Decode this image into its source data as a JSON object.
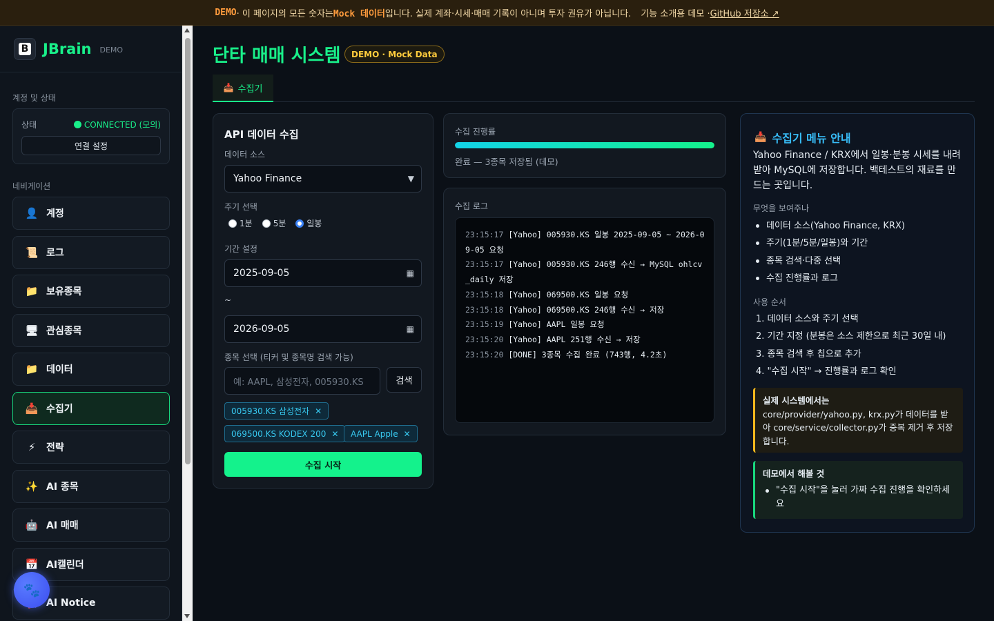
{
  "banner": {
    "demo": "DEMO",
    "text_a": " · 이 페이지의 모든 숫자는 ",
    "mock": "Mock 데이터",
    "text_b": "입니다. 실제 계좌·시세·매매 기록이 아니며 투자 권유가 아닙니다.",
    "text_c": "기능 소개용 데모 · ",
    "github": "GitHub 저장소 ↗"
  },
  "brand": {
    "logo_letter": "B",
    "name": "JBrain",
    "tag": "DEMO"
  },
  "account": {
    "section_label": "계정 및 상태",
    "status_key": "상태",
    "status_value": "CONNECTED (모의)",
    "connect_button": "연결 설정"
  },
  "nav": {
    "section_label": "네비게이션",
    "items": [
      {
        "label": "계정",
        "icon": "👤"
      },
      {
        "label": "로그",
        "icon": "📜"
      },
      {
        "label": "보유종목",
        "icon": "📁"
      },
      {
        "label": "관심종목",
        "icon": "🖥"
      },
      {
        "label": "데이터",
        "icon": "📁"
      },
      {
        "label": "수집기",
        "icon": "📥"
      },
      {
        "label": "전략",
        "icon": "⚡"
      },
      {
        "label": "AI 종목",
        "icon": "✨"
      },
      {
        "label": "AI 매매",
        "icon": "🤖"
      },
      {
        "label": "AI캘린더",
        "icon": "📅"
      },
      {
        "label": "AI Notice",
        "icon": "📢"
      }
    ],
    "active_index": 5
  },
  "fab_icon": "🐾",
  "page": {
    "title": "단타 매매 시스템",
    "badge": "DEMO · Mock Data",
    "tab": {
      "icon": "📥",
      "label": "수집기"
    }
  },
  "collect_form": {
    "title": "API 데이터 수집",
    "source_label": "데이터 소스",
    "source_value": "Yahoo Finance",
    "interval_label": "주기 선택",
    "interval_options": [
      "1분",
      "5분",
      "일봉"
    ],
    "interval_selected": "일봉",
    "period_label": "기간 설정",
    "start_date": "2025-09-05",
    "tilde": "~",
    "end_date": "2026-09-05",
    "ticker_label": "종목 선택 (티커 및 종목명 검색 가능)",
    "ticker_placeholder": "예: AAPL, 삼성전자, 005930.KS",
    "search_button": "검색",
    "chips": [
      "005930.KS 삼성전자",
      "069500.KS KODEX 200",
      "AAPL Apple"
    ],
    "start_button": "수집 시작"
  },
  "progress": {
    "label": "수집 진행률",
    "fraction": 1.0,
    "status": "완료 — 3종목 저장됨 (데모)"
  },
  "log": {
    "label": "수집 로그",
    "lines": [
      {
        "ts": "23:15:17",
        "msg": "[Yahoo] 005930.KS 일봉 2025-09-05 ~ 2026-09-05 요청"
      },
      {
        "ts": "23:15:17",
        "msg": "[Yahoo] 005930.KS 246행 수신 → MySQL ohlcv_daily 저장"
      },
      {
        "ts": "23:15:18",
        "msg": "[Yahoo] 069500.KS 일봉 요청"
      },
      {
        "ts": "23:15:18",
        "msg": "[Yahoo] 069500.KS 246행 수신 → 저장"
      },
      {
        "ts": "23:15:19",
        "msg": "[Yahoo] AAPL 일봉 요청"
      },
      {
        "ts": "23:15:20",
        "msg": "[Yahoo] AAPL 251행 수신 → 저장"
      },
      {
        "ts": "23:15:20",
        "msg": "[DONE] 3종목 수집 완료 (743행, 4.2초)"
      }
    ]
  },
  "guide": {
    "icon": "📥",
    "title": "수집기 메뉴 안내",
    "description": "Yahoo Finance / KRX에서 일봉·분봉 시세를 내려받아 MySQL에 저장합니다. 백테스트의 재료를 만드는 곳입니다.",
    "shows_label": "무엇을 보여주나",
    "shows": [
      "데이터 소스(Yahoo Finance, KRX)",
      "주기(1분/5분/일봉)와 기간",
      "종목 검색·다중 선택",
      "수집 진행률과 로그"
    ],
    "steps_label": "사용 순서",
    "steps": [
      "1. 데이터 소스와 주기 선택",
      "2. 기간 지정 (분봉은 소스 제한으로 최근 30일 내)",
      "3. 종목 검색 후 칩으로 추가",
      "4. \"수집 시작\" → 진행률과 로그 확인"
    ],
    "real_title": "실제 시스템에서는",
    "real_text": "core/provider/yahoo.py, krx.py가 데이터를 받아 core/service/collector.py가 중복 제거 후 저장합니다.",
    "try_title": "데모에서 해볼 것",
    "try_items": [
      "\"수집 시작\"을 눌러 가짜 수집 진행을 확인하세요"
    ]
  }
}
